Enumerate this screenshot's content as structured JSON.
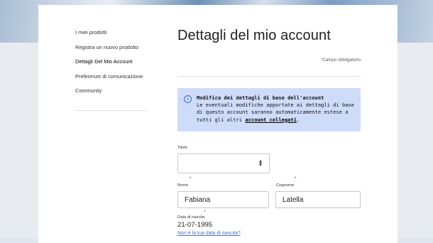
{
  "sidebar": {
    "items": [
      {
        "label": "I miei prodotti"
      },
      {
        "label": "Registra un nuovo prodotto"
      },
      {
        "label": "Dettagli Del Mio Account"
      },
      {
        "label": "Preferenze di comunicazione"
      },
      {
        "label": "Community"
      }
    ],
    "active_index": 2
  },
  "main": {
    "title": "Dettagli del mio account",
    "required_note": "*Campo obbligatorio",
    "info": {
      "icon": "info-icon",
      "title": "Modifica dei dettagli di base dell'account",
      "body_prefix": "Le eventuali modifiche apportate ai dettagli di base di questo account saranno automaticamente estese a tutti gli altri",
      "link_text": "account collegati",
      "body_suffix": "."
    },
    "form": {
      "title_label": "Titolo",
      "title_value": "",
      "first_name_label": "Nome",
      "first_name_value": "Fabiana",
      "last_name_label": "Cognome",
      "last_name_value": "Latella",
      "dob_label": "Data di nascita",
      "dob_value": "21-07-1995",
      "dob_link": "Non è la tua data di nascita?",
      "required_marker": "*"
    }
  },
  "colors": {
    "accent": "#3f6fd0",
    "info_bg": "#cfdcf9"
  }
}
